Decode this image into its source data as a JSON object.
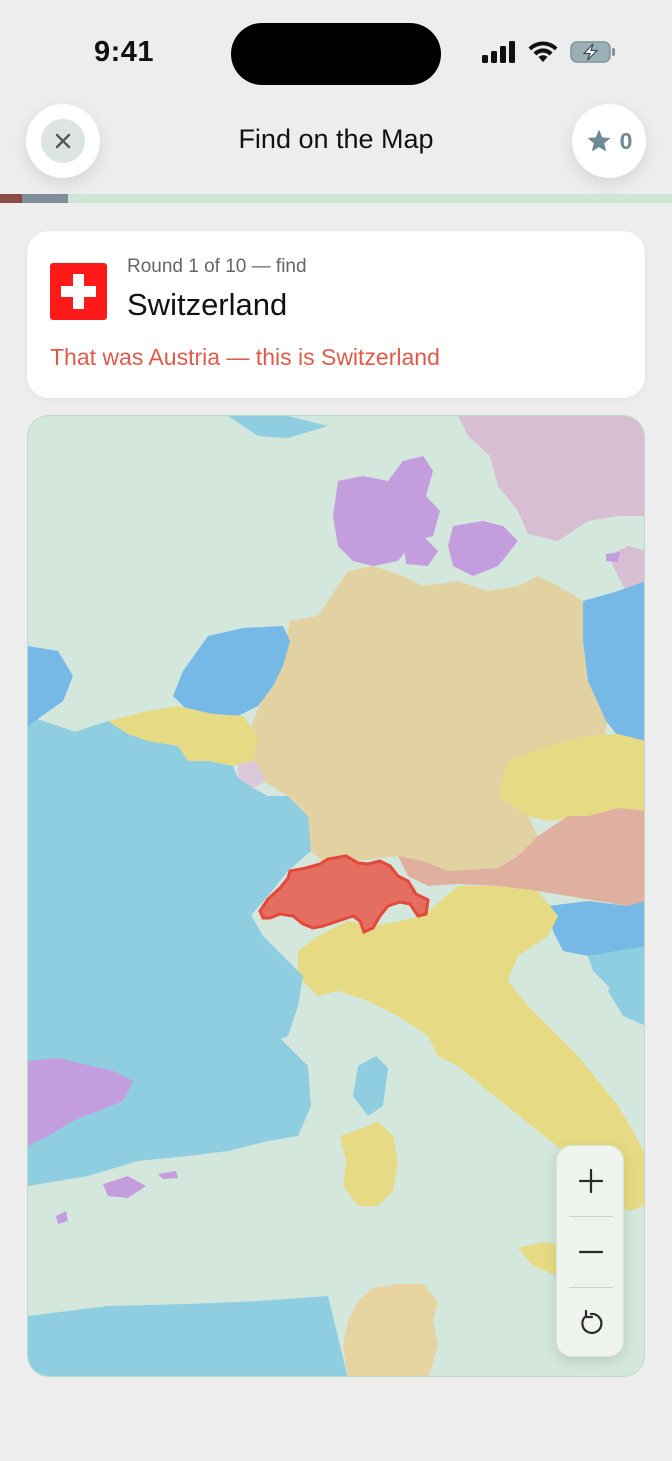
{
  "status": {
    "time": "9:41"
  },
  "header": {
    "title": "Find on the Map",
    "score": "0"
  },
  "progress": {
    "segments": [
      "#8b4a46",
      "#7e8f9a"
    ]
  },
  "prompt": {
    "round_text": "Round 1 of 10 — find",
    "country": "Switzerland",
    "feedback": "That was Austria — this is Switzerland"
  },
  "map": {
    "highlighted_country": "Switzerland",
    "highlight_color": "#e46e60",
    "sea_color": "#d3e7dd",
    "ocean_color": "#8fcde0"
  },
  "controls": {
    "zoom_in_icon": "plus-icon",
    "zoom_out_icon": "minus-icon",
    "reset_icon": "reset-icon"
  }
}
